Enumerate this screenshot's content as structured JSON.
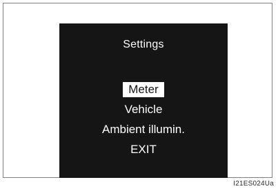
{
  "screen": {
    "title": "Settings",
    "menu_items": [
      {
        "label": "Meter",
        "selected": true
      },
      {
        "label": "Vehicle",
        "selected": false
      },
      {
        "label": "Ambient illumin.",
        "selected": false
      },
      {
        "label": "EXIT",
        "selected": false
      }
    ]
  },
  "caption": "I21ES024Ua",
  "colors": {
    "screen_background": "#151515",
    "text": "#ffffff",
    "selection_background": "#ffffff",
    "frame_border": "#808080"
  }
}
